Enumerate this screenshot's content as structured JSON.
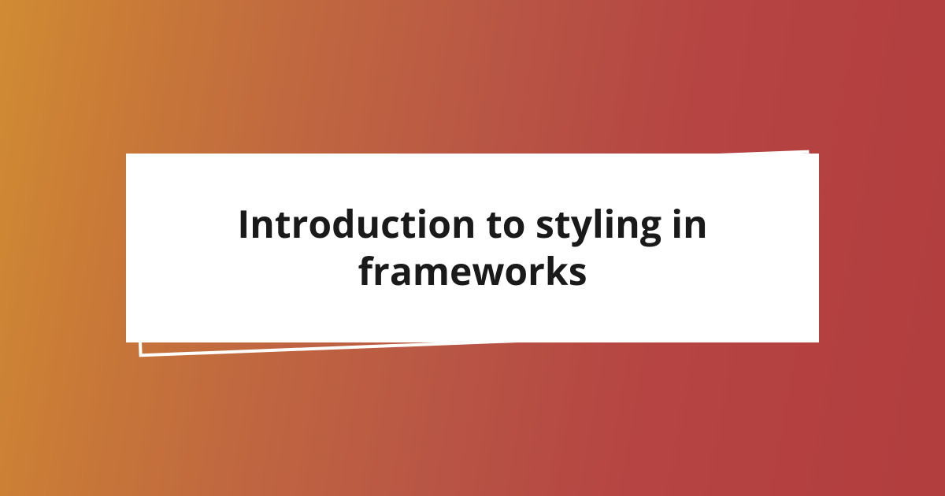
{
  "card": {
    "title": "Introduction to styling in frameworks"
  }
}
